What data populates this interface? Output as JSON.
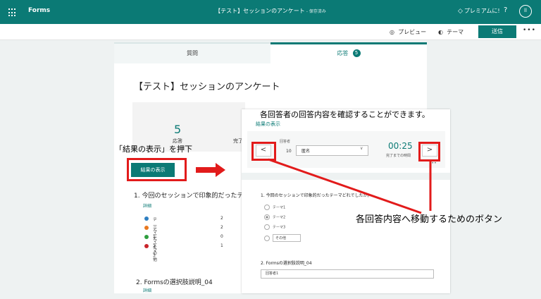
{
  "header": {
    "app_name": "Forms",
    "doc_title": "【テスト】セッションのアンケート",
    "saved_status": "- 保存済み",
    "premium_label": "プレミアムに!",
    "help_label": "?",
    "avatar_initial": "ll"
  },
  "command_bar": {
    "preview_label": "プレビュー",
    "theme_label": "テーマ",
    "send_label": "送信",
    "more_label": "•••"
  },
  "tabs": {
    "questions_label": "質問",
    "responses_label": "応答",
    "responses_count": "5"
  },
  "summary": {
    "form_title": "【テスト】セッションのアンケート",
    "response_count": "5",
    "response_label": "応答",
    "complete_label": "完了",
    "view_results_label": "結果の表示"
  },
  "questions": [
    {
      "title": "1. 今回のセッションで印象的だったテ",
      "details_label": "詳細",
      "legend": [
        {
          "label": "テーマ1",
          "count": "2",
          "color": "#2e7fc1"
        },
        {
          "label": "テーマ2",
          "count": "2",
          "color": "#e8781f"
        },
        {
          "label": "テーマ3",
          "count": "0",
          "color": "#2e9e3e"
        },
        {
          "label": "その他",
          "count": "1",
          "color": "#c9242b"
        }
      ]
    },
    {
      "title": "2. Formsの選択肢説明_04",
      "details_label": "詳細"
    }
  ],
  "annotations": {
    "press_button_caption": "「結果の表示」を押下",
    "overlay_caption": "各回答者の回答内容を確認することができます。",
    "nav_buttons_caption": "各回答内容へ移動するためのボタン"
  },
  "response_view": {
    "view_results_link": "結果の表示",
    "respondent_label": "回答者",
    "respondent_number": "10",
    "respondent_name": "匿名",
    "prev_label": "<",
    "next_label": ">",
    "elapsed_time": "00:25",
    "elapsed_label": "完了までの時間",
    "more_label": "•••",
    "q1_title": "1. 今回のセッションで印象的だったテーマどれでしたか。",
    "q1_options": [
      "テーマ1",
      "テーマ2",
      "テーマ3"
    ],
    "q1_other_label": "その他",
    "q2_title": "2. Formsの選択肢説明_04",
    "q2_answer": "回答者1"
  },
  "colors": {
    "accent": "#0b7a75",
    "callout_red": "#e21b1b"
  }
}
